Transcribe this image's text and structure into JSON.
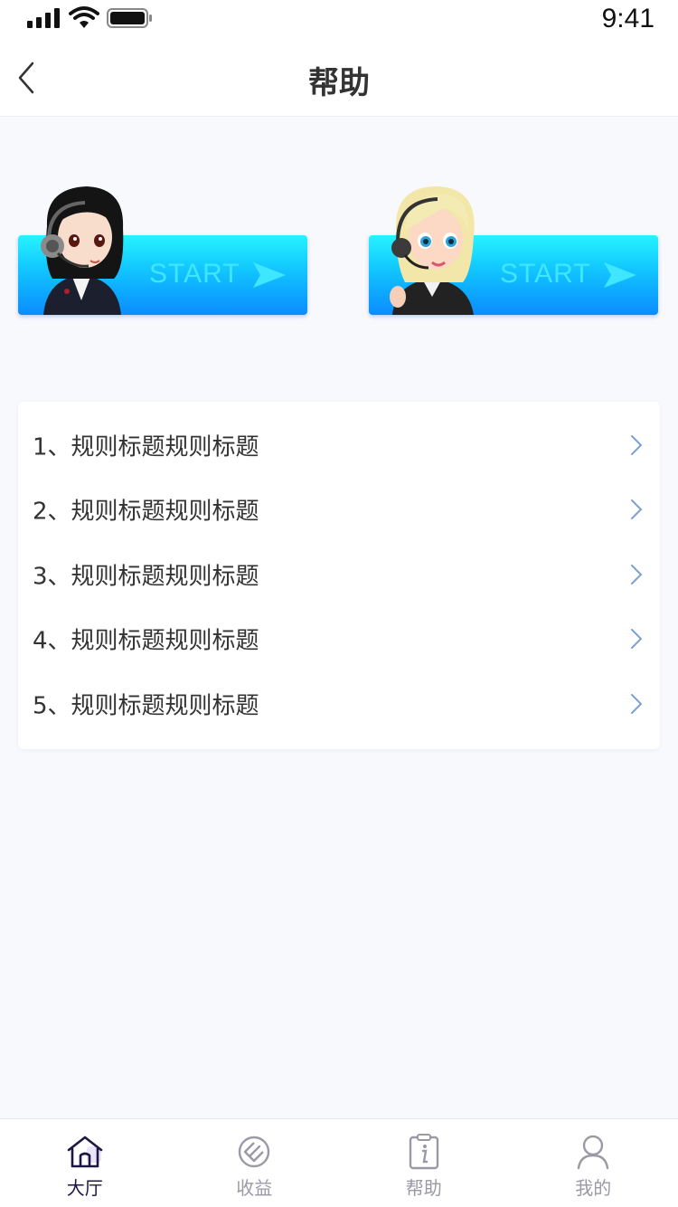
{
  "status_bar": {
    "time": "9:41"
  },
  "nav": {
    "title": "帮助"
  },
  "start_cards": [
    {
      "label": "START",
      "agent": "dark-hair-agent-avatar"
    },
    {
      "label": "START",
      "agent": "blonde-agent-avatar"
    }
  ],
  "rules": [
    {
      "label": "1、规则标题规则标题"
    },
    {
      "label": "2、规则标题规则标题"
    },
    {
      "label": "3、规则标题规则标题"
    },
    {
      "label": "4、规则标题规则标题"
    },
    {
      "label": "5、规则标题规则标题"
    }
  ],
  "tabs": [
    {
      "label": "大厅",
      "icon": "home-icon",
      "active": true
    },
    {
      "label": "收益",
      "icon": "earnings-icon",
      "active": false
    },
    {
      "label": "帮助",
      "icon": "help-info-icon",
      "active": false
    },
    {
      "label": "我的",
      "icon": "profile-icon",
      "active": false
    }
  ],
  "colors": {
    "accent_dark": "#1f1646",
    "start_gradient_top": "#27f3ff",
    "start_gradient_bottom": "#0a8cff",
    "chevron": "#7aa2d6",
    "background": "#f7f9fd"
  }
}
